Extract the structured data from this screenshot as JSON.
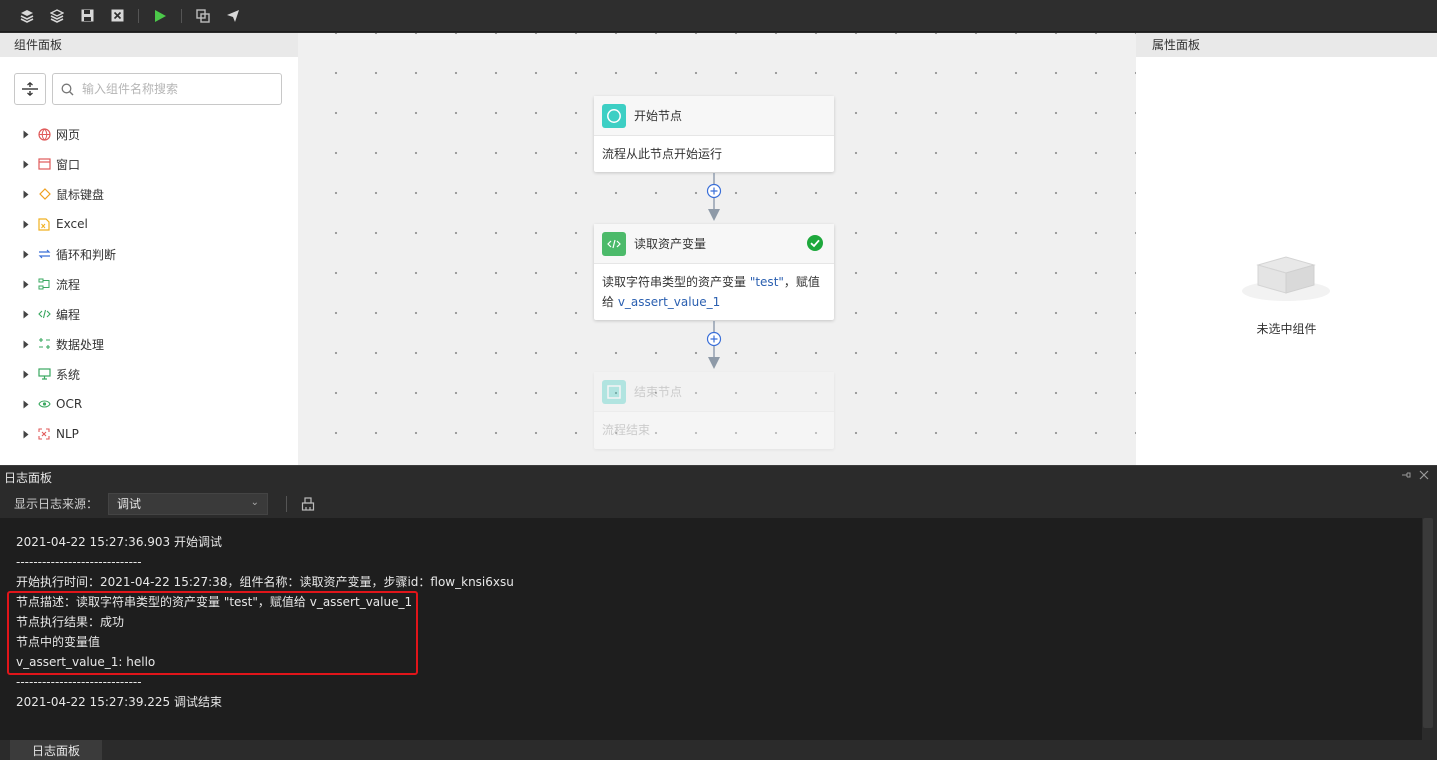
{
  "toolbar": {
    "buttons": [
      "layers-up-icon",
      "layers-down-icon",
      "save-icon",
      "close-icon",
      "run-icon",
      "copy-icon",
      "send-icon"
    ],
    "run_color": "#4cc94a"
  },
  "left_panel": {
    "title": "组件面板",
    "search_placeholder": "输入组件名称搜索",
    "items": [
      {
        "label": "网页",
        "icon": "globe-icon",
        "color": "#e05a5a"
      },
      {
        "label": "窗口",
        "icon": "window-icon",
        "color": "#e05a5a"
      },
      {
        "label": "鼠标键盘",
        "icon": "eraser-icon",
        "color": "#f0a020"
      },
      {
        "label": "Excel",
        "icon": "excel-icon",
        "color": "#f0b020"
      },
      {
        "label": "循环和判断",
        "icon": "loop-icon",
        "color": "#3a6fd8"
      },
      {
        "label": "流程",
        "icon": "flow-icon",
        "color": "#3aa860"
      },
      {
        "label": "编程",
        "icon": "code-icon",
        "color": "#3aa860"
      },
      {
        "label": "数据处理",
        "icon": "data-icon",
        "color": "#3aa860"
      },
      {
        "label": "系统",
        "icon": "monitor-icon",
        "color": "#3aa860"
      },
      {
        "label": "OCR",
        "icon": "eye-icon",
        "color": "#3aa860"
      },
      {
        "label": "NLP",
        "icon": "nlp-icon",
        "color": "#e05a5a"
      }
    ]
  },
  "canvas": {
    "nodes": [
      {
        "title": "开始节点",
        "desc": "流程从此节点开始运行"
      },
      {
        "title": "读取资产变量",
        "desc_prefix": "读取字符串类型的资产变量 ",
        "desc_var": "\"test\"",
        "desc_mid": "，赋值给 ",
        "desc_target": "v_assert_value_1"
      },
      {
        "title": "结束节点",
        "desc": "流程结束"
      }
    ]
  },
  "right_panel": {
    "title": "属性面板",
    "empty_text": "未选中组件"
  },
  "log_panel": {
    "title": "日志面板",
    "source_label": "显示日志来源：",
    "source_value": "调试",
    "lines": [
      "2021-04-22 15:27:36.903 开始调试",
      "-----------------------------",
      "开始执行时间：2021-04-22 15:27:38，组件名称：读取资产变量，步骤id：flow_knsi6xsu",
      "节点描述：读取字符串类型的资产变量 \"test\"，赋值给 v_assert_value_1",
      "节点执行结果：成功",
      "节点中的变量值",
      "v_assert_value_1: hello",
      "-----------------------------",
      "2021-04-22 15:27:39.225 调试结束"
    ],
    "bottom_tab": "日志面板"
  }
}
